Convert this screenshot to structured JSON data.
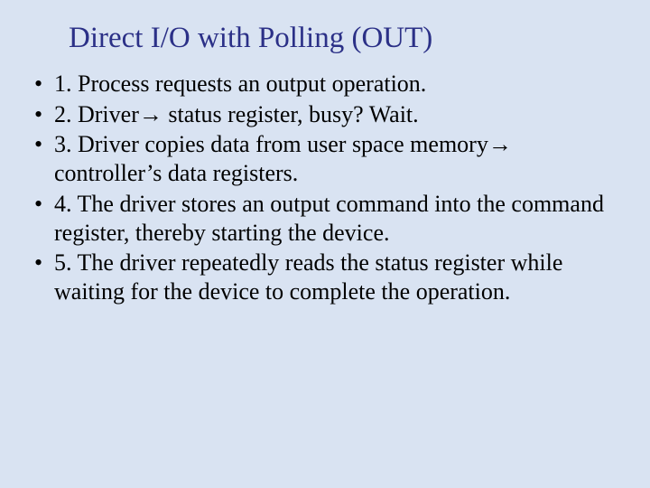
{
  "slide": {
    "title": "Direct I/O with Polling (OUT)",
    "items": [
      {
        "pre": "1. Process requests an output operation.",
        "arrow": "",
        "post": ""
      },
      {
        "pre": "2. Driver",
        "arrow": "→",
        "post": " status register, busy? Wait."
      },
      {
        "pre": "3. Driver copies data from user space memory",
        "arrow": "→",
        "post": " controller’s data registers."
      },
      {
        "pre": "4. The driver stores an output command into the command register, thereby starting the device.",
        "arrow": "",
        "post": ""
      },
      {
        "pre": "5. The driver repeatedly reads the status register while waiting for the device to complete the operation.",
        "arrow": "",
        "post": ""
      }
    ]
  }
}
